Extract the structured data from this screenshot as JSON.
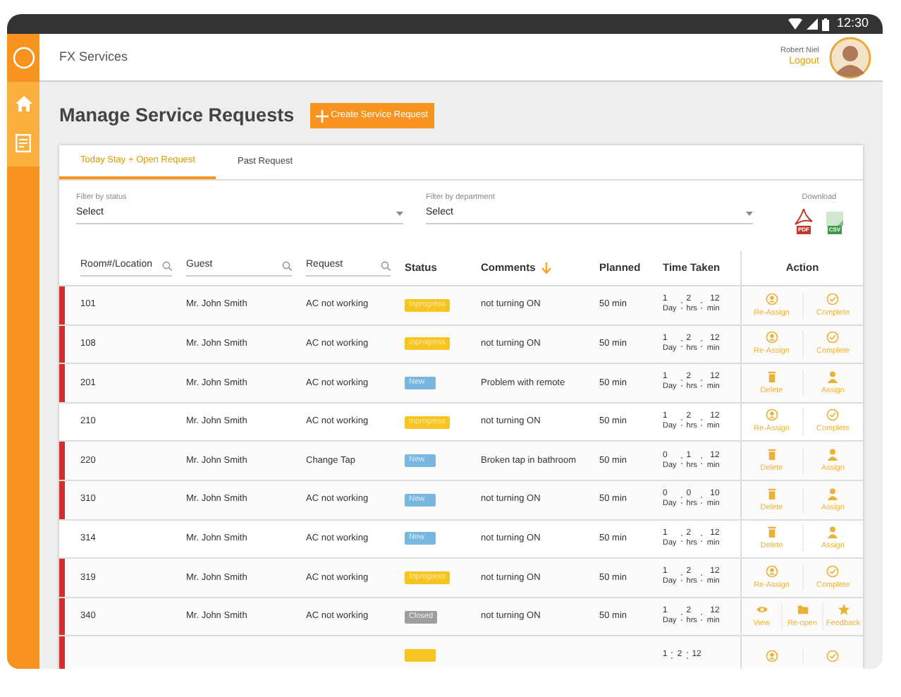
{
  "status_bar": {
    "time": "12:30"
  },
  "header": {
    "app_name": "FX Services",
    "user_name": "Robert Niel",
    "logout": "Logout"
  },
  "page": {
    "title": "Manage Service Requests",
    "create_button": "Create Service Request"
  },
  "tabs": [
    {
      "label": "Today Stay + Open Request",
      "selected": true
    },
    {
      "label": "Past Request",
      "selected": false
    }
  ],
  "filters": [
    {
      "label": "Filter by status",
      "value": "Select"
    },
    {
      "label": "Filter by department",
      "value": "Select"
    }
  ],
  "download": {
    "label": "Download",
    "formats": [
      {
        "kind": "pdf",
        "label": "PDF"
      },
      {
        "kind": "csv",
        "label": "CSV"
      }
    ]
  },
  "table": {
    "columns": [
      {
        "label": "Room#/Location",
        "searchable": true
      },
      {
        "label": "Guest",
        "searchable": true
      },
      {
        "label": "Request",
        "searchable": true
      },
      {
        "label": "Status",
        "searchable": false
      },
      {
        "label": "Comments",
        "searchable": false,
        "sorted": true
      },
      {
        "label": "Planned",
        "searchable": false
      },
      {
        "label": "Time Taken",
        "searchable": false
      },
      {
        "label": "Action",
        "searchable": false
      }
    ],
    "rows": [
      {
        "room": "101",
        "guest": "Mr. John Smith",
        "request": "AC not working",
        "status": {
          "kind": "inprogress",
          "label": "Inprogress"
        },
        "comment": "not turning ON",
        "planned": "50 min",
        "time": [
          {
            "value": "1",
            "unit": "Day"
          },
          {
            "value": "2",
            "unit": "hrs"
          },
          {
            "value": "12",
            "unit": "min"
          }
        ],
        "overdue": true,
        "actions": [
          {
            "kind": "reassign",
            "label": "Re-Assign"
          },
          {
            "kind": "complete",
            "label": "Complete"
          }
        ]
      },
      {
        "room": "108",
        "guest": "Mr. John Smith",
        "request": "AC not working",
        "status": {
          "kind": "inprogress",
          "label": "Inprogress"
        },
        "comment": "not turning ON",
        "planned": "50 min",
        "time": [
          {
            "value": "1",
            "unit": "Day"
          },
          {
            "value": "2",
            "unit": "hrs"
          },
          {
            "value": "12",
            "unit": "min"
          }
        ],
        "overdue": true,
        "actions": [
          {
            "kind": "reassign",
            "label": "Re-Assign"
          },
          {
            "kind": "complete",
            "label": "Complete"
          }
        ]
      },
      {
        "room": "201",
        "guest": "Mr. John Smith",
        "request": "AC not working",
        "status": {
          "kind": "new",
          "label": "New"
        },
        "comment": "Problem with remote",
        "planned": "50 min",
        "time": [
          {
            "value": "1",
            "unit": "Day"
          },
          {
            "value": "2",
            "unit": "hrs"
          },
          {
            "value": "12",
            "unit": "min"
          }
        ],
        "overdue": true,
        "actions": [
          {
            "kind": "delete",
            "label": "Delete"
          },
          {
            "kind": "assign",
            "label": "Assign"
          }
        ]
      },
      {
        "room": "210",
        "guest": "Mr. John Smith",
        "request": "AC not working",
        "status": {
          "kind": "inprogress",
          "label": "Inprogress"
        },
        "comment": "not turning ON",
        "planned": "50 min",
        "time": [
          {
            "value": "1",
            "unit": "Day"
          },
          {
            "value": "2",
            "unit": "hrs"
          },
          {
            "value": "12",
            "unit": "min"
          }
        ],
        "overdue": false,
        "actions": [
          {
            "kind": "reassign",
            "label": "Re-Assign"
          },
          {
            "kind": "complete",
            "label": "Complete"
          }
        ]
      },
      {
        "room": "220",
        "guest": "Mr. John Smith",
        "request": "Change Tap",
        "status": {
          "kind": "new",
          "label": "New"
        },
        "comment": "Broken tap in bathroom",
        "planned": "50 min",
        "time": [
          {
            "value": "0",
            "unit": "Day"
          },
          {
            "value": "1",
            "unit": "hrs"
          },
          {
            "value": "12",
            "unit": "min"
          }
        ],
        "overdue": true,
        "actions": [
          {
            "kind": "delete",
            "label": "Delete"
          },
          {
            "kind": "assign",
            "label": "Assign"
          }
        ]
      },
      {
        "room": "310",
        "guest": "Mr. John Smith",
        "request": "AC not working",
        "status": {
          "kind": "new",
          "label": "New"
        },
        "comment": "not turning ON",
        "planned": "50 min",
        "time": [
          {
            "value": "0",
            "unit": "Day"
          },
          {
            "value": "0",
            "unit": "hrs"
          },
          {
            "value": "10",
            "unit": "min"
          }
        ],
        "overdue": true,
        "actions": [
          {
            "kind": "delete",
            "label": "Delete"
          },
          {
            "kind": "assign",
            "label": "Assign"
          }
        ]
      },
      {
        "room": "314",
        "guest": "Mr. John Smith",
        "request": "AC not working",
        "status": {
          "kind": "new",
          "label": "New"
        },
        "comment": "not turning ON",
        "planned": "50 min",
        "time": [
          {
            "value": "1",
            "unit": "Day"
          },
          {
            "value": "2",
            "unit": "hrs"
          },
          {
            "value": "12",
            "unit": "min"
          }
        ],
        "overdue": false,
        "actions": [
          {
            "kind": "delete",
            "label": "Delete"
          },
          {
            "kind": "assign",
            "label": "Assign"
          }
        ]
      },
      {
        "room": "319",
        "guest": "Mr. John Smith",
        "request": "AC not working",
        "status": {
          "kind": "inprogress",
          "label": "Inprogress"
        },
        "comment": "not turning ON",
        "planned": "50 min",
        "time": [
          {
            "value": "1",
            "unit": "Day"
          },
          {
            "value": "2",
            "unit": "hrs"
          },
          {
            "value": "12",
            "unit": "min"
          }
        ],
        "overdue": true,
        "actions": [
          {
            "kind": "reassign",
            "label": "Re-Assign"
          },
          {
            "kind": "complete",
            "label": "Complete"
          }
        ]
      },
      {
        "room": "340",
        "guest": "Mr. John Smith",
        "request": "AC not working",
        "status": {
          "kind": "closed",
          "label": "Closed"
        },
        "comment": "not turning ON",
        "planned": "50 min",
        "time": [
          {
            "value": "1",
            "unit": "Day"
          },
          {
            "value": "2",
            "unit": "hrs"
          },
          {
            "value": "12",
            "unit": "min"
          }
        ],
        "overdue": true,
        "actions": [
          {
            "kind": "view",
            "label": "View"
          },
          {
            "kind": "reopen",
            "label": "Re-open"
          },
          {
            "kind": "feedback",
            "label": "Feedback"
          }
        ]
      },
      {
        "status": {
          "kind": "inprogress"
        },
        "time": [
          {
            "value": "1"
          },
          {
            "value": "2"
          },
          {
            "value": "12"
          }
        ],
        "overdue": true,
        "actions": [
          {
            "kind": "reassign"
          },
          {
            "kind": "complete"
          }
        ]
      }
    ]
  }
}
